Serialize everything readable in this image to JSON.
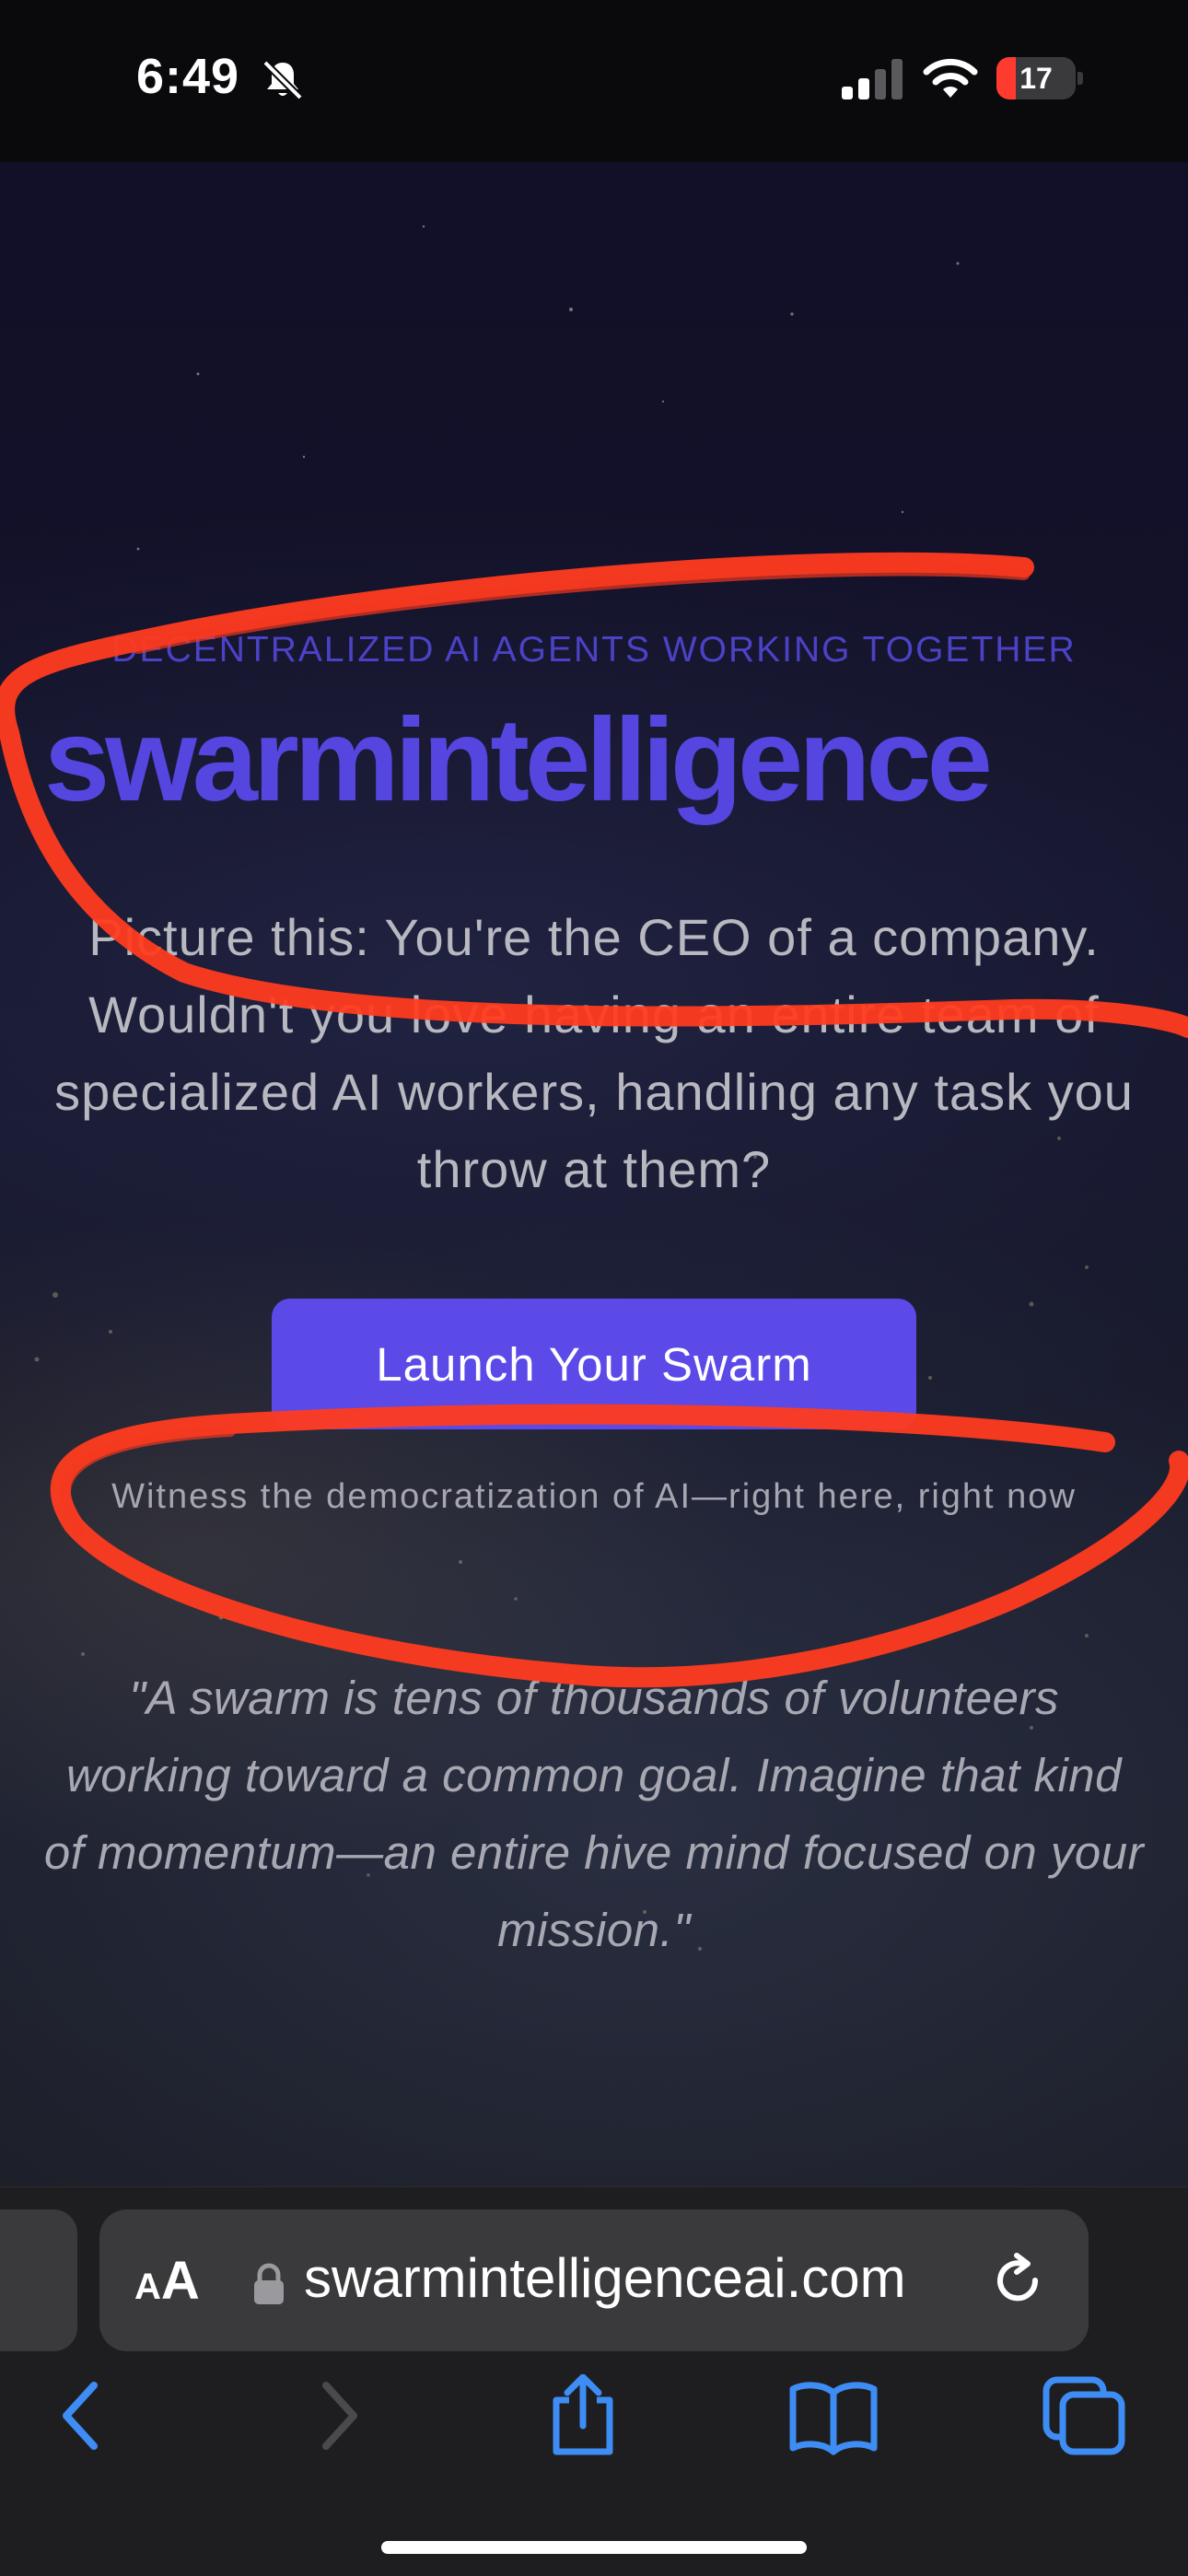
{
  "status_bar": {
    "time": "6:49",
    "battery_level": "17",
    "battery_fraction": 0.17,
    "icons": [
      "bell-slash-icon",
      "cellular-signal-icon",
      "wifi-icon",
      "battery-icon"
    ]
  },
  "hero": {
    "tagline": "DECENTRALIZED AI AGENTS WORKING TOGETHER",
    "brand": "swarmintelligence",
    "intro": "Picture this: You're the CEO of a company. Wouldn't you love having an entire team of specialized AI workers, handling any task you throw at them?",
    "cta_label": "Launch Your Swarm",
    "subline": "Witness the democratization of AI—right here, right now",
    "quote": "\"A swarm is tens of thousands of volunteers working toward a common goal. Imagine that kind of momentum—an entire hive mind focused on your mission.\""
  },
  "browser": {
    "aa_small": "A",
    "aa_big": "A",
    "url": "swarmintelligenceai.com",
    "toolbar_icons": [
      "back-icon",
      "forward-icon",
      "share-icon",
      "bookmarks-icon",
      "tabs-icon"
    ]
  },
  "colors": {
    "accent": "#5b4ae8",
    "brand_text": "#5546e0",
    "scribble": "#ff3b1f",
    "toolbar_blue": "#3d8df5",
    "battery_low": "#ff3b30"
  }
}
